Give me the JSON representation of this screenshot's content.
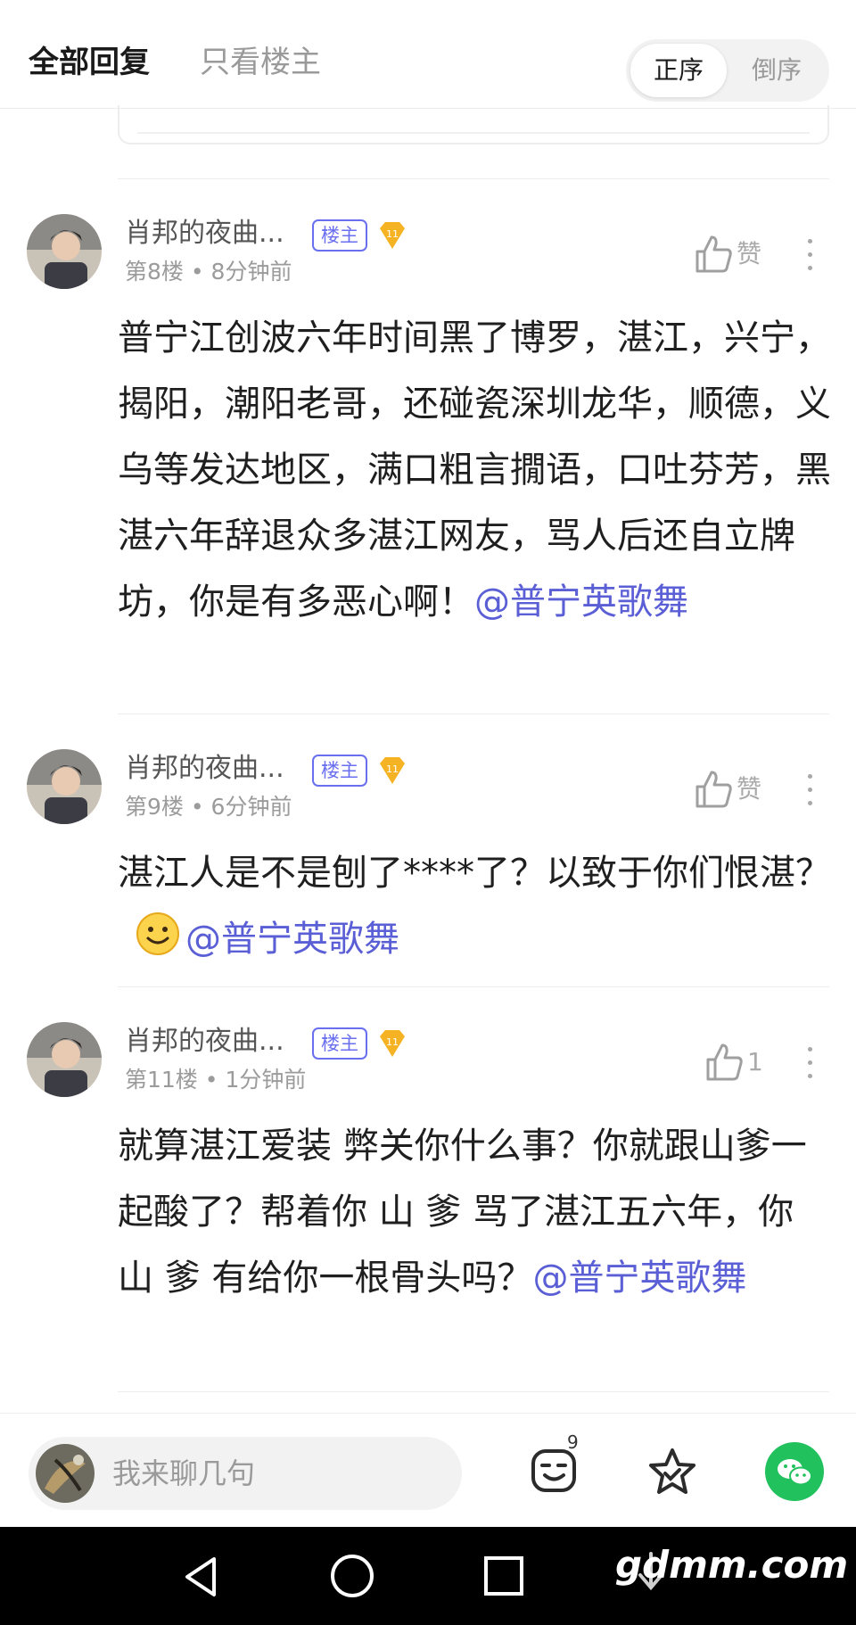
{
  "header": {
    "tab_all": "全部回复",
    "tab_op_only": "只看楼主",
    "order_asc": "正序",
    "order_desc": "倒序"
  },
  "comments": [
    {
      "username": "肖邦的夜曲...",
      "op_badge": "楼主",
      "level": "11",
      "meta": "第8楼 • 8分钟前",
      "like_label": "赞",
      "body_text": "普宁江创波六年时间黑了博罗，湛江，兴宁，揭阳，潮阳老哥，还碰瓷深圳龙华，顺德，义乌等发达地区，满口粗言撊语，口吐芬芳，黑湛六年辞退众多湛江网友，骂人后还自立牌 坊，你是有多恶心啊！",
      "mention": "@普宁英歌舞"
    },
    {
      "username": "肖邦的夜曲...",
      "op_badge": "楼主",
      "level": "11",
      "meta": "第9楼 • 6分钟前",
      "like_label": "赞",
      "body_text": "湛江人是不是刨了****了？以致于你们恨湛？",
      "mention": "@普宁英歌舞"
    },
    {
      "username": "肖邦的夜曲...",
      "op_badge": "楼主",
      "level": "11",
      "meta": "第11楼 • 1分钟前",
      "like_label": "1",
      "body_text": "就算湛江爱装 弊关你什么事？你就跟山爹一起酸了？帮着你 山 爹 骂了湛江五六年，你 山 爹 有给你一根骨头吗？",
      "mention": "@普宁英歌舞"
    }
  ],
  "input_bar": {
    "placeholder": "我来聊几句",
    "emoji_count": "9"
  },
  "navbar": {
    "watermark": "gdmm.com"
  },
  "colors": {
    "accent_purple": "#5b5fd6",
    "badge_purple": "#6a6ff0",
    "level_gold": "#f5b324",
    "wechat_green": "#21c15e"
  }
}
